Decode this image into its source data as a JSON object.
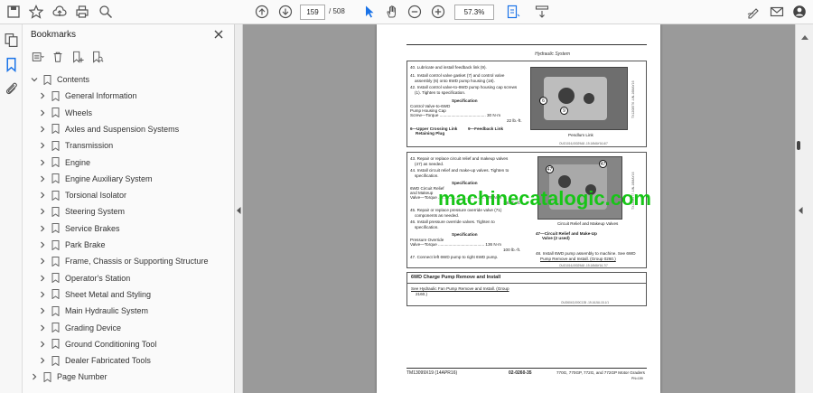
{
  "toolbar": {
    "page_current": "159",
    "page_total": "/ 508",
    "zoom": "57.3%"
  },
  "bookmarks": {
    "title": "Bookmarks",
    "items": [
      {
        "label": "Contents",
        "level": 0
      },
      {
        "label": "General Information",
        "level": 1
      },
      {
        "label": "Wheels",
        "level": 1
      },
      {
        "label": "Axles and Suspension Systems",
        "level": 1
      },
      {
        "label": "Transmission",
        "level": 1
      },
      {
        "label": "Engine",
        "level": 1
      },
      {
        "label": "Engine Auxiliary System",
        "level": 1
      },
      {
        "label": "Torsional Isolator",
        "level": 1
      },
      {
        "label": "Steering System",
        "level": 1
      },
      {
        "label": "Service Brakes",
        "level": 1
      },
      {
        "label": "Park Brake",
        "level": 1
      },
      {
        "label": "Frame, Chassis or Supporting Structure",
        "level": 1
      },
      {
        "label": "Operator's Station",
        "level": 1
      },
      {
        "label": "Sheet Metal and Styling",
        "level": 1
      },
      {
        "label": "Main Hydraulic System",
        "level": 1
      },
      {
        "label": "Grading Device",
        "level": 1
      },
      {
        "label": "Ground Conditioning Tool",
        "level": 1
      },
      {
        "label": "Dealer Fabricated Tools",
        "level": 1
      },
      {
        "label": "Page Number",
        "level": 0
      }
    ]
  },
  "document": {
    "header": "Hydraulic System",
    "box1": {
      "steps": [
        "40. Lubricate and install feedback link (9).",
        "41. Install control valve gasket (7) and control valve",
        "assembly (6) onto 6WD pump housing (18).",
        "42. Install control valve-to-6WD pump housing cap screws",
        "(1). Tighten to specification."
      ],
      "spec_title": "Specification",
      "spec_lines": [
        "Control Valve-to-6WD",
        "Pump Housing Cap",
        "Screw—Torque ........................................ 30 N·m",
        "22 lb.-ft."
      ],
      "legend_left": "6—Upper Crossing Link",
      "legend_left2": "Retaining Plug",
      "legend_right": "9—Feedback Link",
      "photo_caption": "Pendlum Link",
      "callouts": [
        "6",
        "9"
      ],
      "ref": "OUO1016,00029A8 -19-16MAY16-6/7",
      "vert": "TX1208576 -UN-16MAY16"
    },
    "box2": {
      "steps": [
        "43. Repair or replace circuit relief and makeup valves",
        "(47) as needed.",
        "44. Install circuit relief and make-up valves. Tighten to",
        "specification."
      ],
      "spec_title": "Specification",
      "spec_lines": [
        "6WD Circuit Relief",
        "and Makeup",
        "Valve—Torque ........................................ 176 N·m",
        "130 lb.-ft."
      ],
      "steps2": [
        "45. Repair or replace pressure override valve (71)",
        "components as needed.",
        "46. Install pressure override valves. Tighten to",
        "specification."
      ],
      "spec2_title": "Specification",
      "spec2_lines": [
        "Pressure Override",
        "Valve—Torque ........................................ 136 N·m",
        "100 lb.-ft."
      ],
      "step47": "47. Connect left 6WD pump to right 6WD pump.",
      "photo_caption": "Circuit Relief and Makeup Valves",
      "legend": "47—Circuit Relief and Make-Up",
      "legend2": "Valve (2 used)",
      "step48": "48. Install 6WD pump assembly to machine. See 6WD",
      "step48b": "Pump Remove and Install. (Group 0260.)",
      "callouts": [
        "47",
        "47"
      ],
      "ref": "OUO1016,00029A8 -19-16MAY16-7/7",
      "vert": "TX1208577 -UN-16MAY16"
    },
    "box3": {
      "title": "6WD Charge Pump Remove and Install",
      "line1": "See Hydraulic Fan Pump Remove and Install. (Group",
      "line2": "2160.)",
      "ref": "OUO6043,000C135 -19-16JUL15-1/1"
    },
    "watermark": "machinecatalogic.com",
    "footer_left": "TM13099X19 (14APR16)",
    "footer_mid": "02-0260-35",
    "footer_right": "770G, 770GP, 772G, and 772GP Motor Graders",
    "footer_right2": "PN=159"
  },
  "colors": {
    "watermark": "#17c517",
    "accent": "#1a73e8"
  }
}
